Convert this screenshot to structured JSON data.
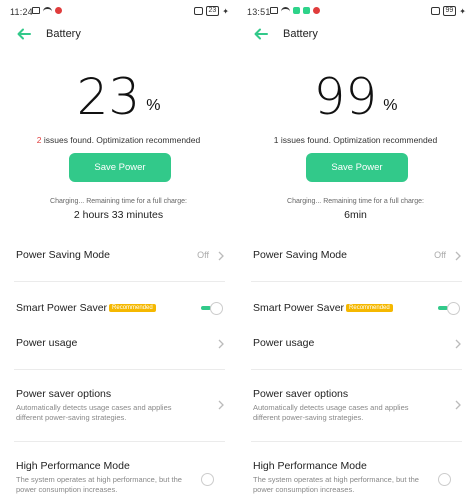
{
  "colors": {
    "accent": "#32c98a",
    "warning_red": "#e03c3c",
    "badge": "#f5b800"
  },
  "screens": [
    {
      "status": {
        "time": "11:24",
        "battery": "23"
      },
      "header": {
        "title": "Battery"
      },
      "battery_percent": "23",
      "percent_sign": "%",
      "issues": {
        "count": "2",
        "text": " issues found. Optimization recommended"
      },
      "save_power_label": "Save Power",
      "charging_label": "Charging... Remaining time for a full charge:",
      "charging_time": "2 hours 33 minutes",
      "power_saving_mode": {
        "label": "Power Saving Mode",
        "value": "Off"
      },
      "smart_power_saver": {
        "label": "Smart Power Saver",
        "badge": "Recommended",
        "enabled": true
      },
      "power_usage": {
        "label": "Power usage"
      },
      "power_saver_options": {
        "label": "Power saver options",
        "description": "Automatically detects usage cases and applies different power-saving strategies."
      },
      "high_performance": {
        "label": "High Performance Mode",
        "description": "The system operates at high performance, but the power consumption increases.",
        "enabled": false
      }
    },
    {
      "status": {
        "time": "13:51",
        "battery": "99"
      },
      "header": {
        "title": "Battery"
      },
      "battery_percent": "99",
      "percent_sign": "%",
      "issues": {
        "count": "",
        "text": "1 issues found. Optimization recommended"
      },
      "save_power_label": "Save Power",
      "charging_label": "Charging... Remaining time for a full charge:",
      "charging_time": "6min",
      "power_saving_mode": {
        "label": "Power Saving Mode",
        "value": "Off"
      },
      "smart_power_saver": {
        "label": "Smart Power Saver",
        "badge": "Recommended",
        "enabled": true
      },
      "power_usage": {
        "label": "Power usage"
      },
      "power_saver_options": {
        "label": "Power saver options",
        "description": "Automatically detects usage cases and applies different power-saving strategies."
      },
      "high_performance": {
        "label": "High Performance Mode",
        "description": "The system operates at high performance, but the power consumption increases.",
        "enabled": false
      }
    }
  ]
}
